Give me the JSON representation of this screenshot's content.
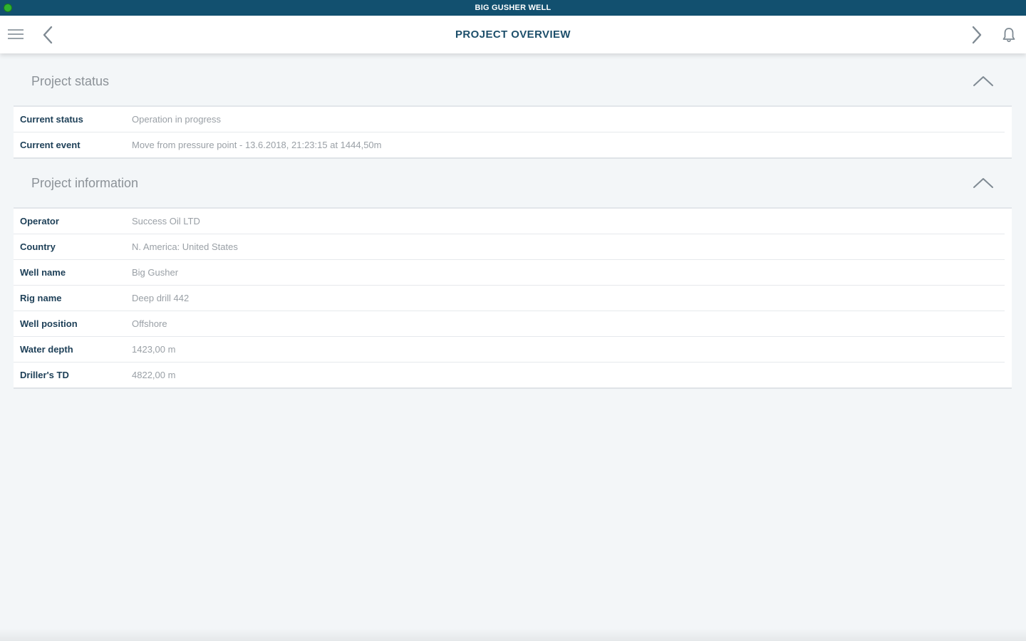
{
  "window": {
    "title": "BIG GUSHER WELL"
  },
  "toolbar": {
    "title": "PROJECT OVERVIEW"
  },
  "sections": [
    {
      "title": "Project status",
      "rows": [
        {
          "label": "Current status",
          "value": "Operation in progress"
        },
        {
          "label": "Current event",
          "value": "Move from pressure point - 13.6.2018, 21:23:15 at 1444,50m"
        }
      ]
    },
    {
      "title": "Project information",
      "rows": [
        {
          "label": "Operator",
          "value": "Success Oil LTD"
        },
        {
          "label": "Country",
          "value": "N. America: United States"
        },
        {
          "label": "Well name",
          "value": "Big Gusher"
        },
        {
          "label": "Rig name",
          "value": "Deep drill 442"
        },
        {
          "label": "Well position",
          "value": "Offshore"
        },
        {
          "label": "Water depth",
          "value": "1423,00 m"
        },
        {
          "label": "Driller's TD",
          "value": "4822,00 m"
        }
      ]
    }
  ],
  "colors": {
    "title_bar": "#12506f",
    "status_indicator": "#2fb32f",
    "toolbar_title": "#1d4f6b",
    "label_text": "#1d3f57",
    "value_text": "#9aa0a6",
    "background": "#f3f6f8"
  },
  "icons": {
    "menu": "menu-icon",
    "back": "chevron-left-icon",
    "next": "chevron-right-icon",
    "notifications": "bell-icon",
    "collapse": "chevron-up-icon"
  }
}
